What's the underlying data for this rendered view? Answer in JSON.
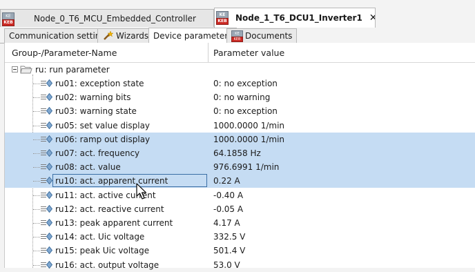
{
  "node_tabs": [
    {
      "label": "Node_0_T6_MCU_Embedded_Controller",
      "active": false
    },
    {
      "label": "Node_1_T6_DCU1_Inverter1",
      "active": true,
      "close_glyph": "✕"
    }
  ],
  "sub_tabs": [
    {
      "label": "Communication settings",
      "active": false
    },
    {
      "label": "Wizards",
      "active": false,
      "icon": "wand-icon"
    },
    {
      "label": "Device parameters",
      "active": true
    },
    {
      "label": "Documents",
      "active": false,
      "icon": "kebus-icon"
    }
  ],
  "tab_icon_text": {
    "top": "KE",
    "bottom": "KEB"
  },
  "grid": {
    "columns": {
      "name": "Group-/Parameter-Name",
      "value": "Parameter value"
    },
    "group": {
      "label": "ru: run parameter",
      "expanded": true
    },
    "rows": [
      {
        "name": "ru01: exception state",
        "value": "0: no exception",
        "selected": false
      },
      {
        "name": "ru02: warning bits",
        "value": "0: no warning",
        "selected": false
      },
      {
        "name": "ru03: warning state",
        "value": "0: no exception",
        "selected": false
      },
      {
        "name": "ru05: set value display",
        "value": "1000.0000 1/min",
        "selected": false
      },
      {
        "name": "ru06: ramp out display",
        "value": "1000.0000 1/min",
        "selected": true
      },
      {
        "name": "ru07: act. frequency",
        "value": "64.1858 Hz",
        "selected": true
      },
      {
        "name": "ru08: act. value",
        "value": "976.6991 1/min",
        "selected": true
      },
      {
        "name": "ru10: act. apparent current",
        "value": "0.22 A",
        "selected": true,
        "focused": true
      },
      {
        "name": "ru11: act. active current",
        "value": "-0.40 A",
        "selected": false
      },
      {
        "name": "ru12: act. reactive current",
        "value": "-0.05 A",
        "selected": false
      },
      {
        "name": "ru13: peak apparent current",
        "value": "4.17 A",
        "selected": false
      },
      {
        "name": "ru14: act. Uic voltage",
        "value": "332.5 V",
        "selected": false
      },
      {
        "name": "ru15: peak Uic voltage",
        "value": "501.4 V",
        "selected": false
      },
      {
        "name": "ru16: act. output voltage",
        "value": "53.0 V",
        "selected": false
      }
    ]
  },
  "colors": {
    "selection": "#c5dcf3",
    "focus_border": "#3a6ea5"
  }
}
